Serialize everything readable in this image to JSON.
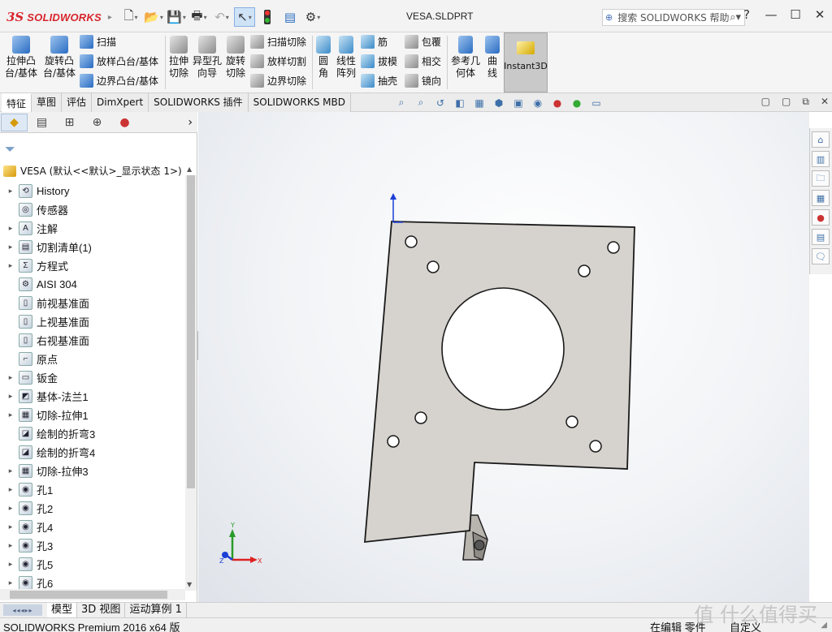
{
  "app": {
    "logo_text": "SOLIDWORKS",
    "document_title": "VESA.SLDPRT",
    "search_placeholder": "搜索 SOLIDWORKS 帮助",
    "window_controls": [
      "?",
      "—",
      "☐",
      "✕"
    ]
  },
  "ribbon": {
    "extrude_boss": "拉伸凸台/基体",
    "revolve_boss": "旋转凸台/基体",
    "sweep": "扫描",
    "loft_boss": "放样凸台/基体",
    "boundary_boss": "边界凸台/基体",
    "extrude_cut": "拉伸切除",
    "hole_wizard": "异型孔向导",
    "revolve_cut": "旋转切除",
    "swept_cut": "扫描切除",
    "lofted_cut": "放样切割",
    "boundary_cut": "边界切除",
    "fillet": "圆角",
    "linear_pattern": "线性阵列",
    "rib": "筋",
    "draft": "拔模",
    "shell": "抽壳",
    "wrap": "包覆",
    "intersect": "相交",
    "mirror": "镜向",
    "ref_geometry": "参考几何体",
    "curves": "曲线",
    "instant3d": "Instant3D"
  },
  "tabs": [
    "特征",
    "草图",
    "评估",
    "DimXpert",
    "SOLIDWORKS 插件",
    "SOLIDWORKS MBD"
  ],
  "tree": {
    "root": "VESA (默认<<默认>_显示状态 1>)",
    "items": [
      {
        "label": "History",
        "expand": true
      },
      {
        "label": "传感器",
        "expand": false
      },
      {
        "label": "注解",
        "expand": true
      },
      {
        "label": "切割清单(1)",
        "expand": true
      },
      {
        "label": "方程式",
        "expand": true
      },
      {
        "label": "AISI 304",
        "expand": false
      },
      {
        "label": "前视基准面",
        "expand": false
      },
      {
        "label": "上视基准面",
        "expand": false
      },
      {
        "label": "右视基准面",
        "expand": false
      },
      {
        "label": "原点",
        "expand": false
      },
      {
        "label": "钣金",
        "expand": true
      },
      {
        "label": "基体-法兰1",
        "expand": true
      },
      {
        "label": "切除-拉伸1",
        "expand": true
      },
      {
        "label": "绘制的折弯3",
        "expand": false
      },
      {
        "label": "绘制的折弯4",
        "expand": false
      },
      {
        "label": "切除-拉伸3",
        "expand": true
      },
      {
        "label": "孔1",
        "expand": true
      },
      {
        "label": "孔2",
        "expand": true
      },
      {
        "label": "孔4",
        "expand": true
      },
      {
        "label": "孔3",
        "expand": true
      },
      {
        "label": "孔5",
        "expand": true
      },
      {
        "label": "孔6",
        "expand": true
      }
    ]
  },
  "bottom_tabs": [
    "模型",
    "3D 视图",
    "运动算例 1"
  ],
  "status": {
    "product": "SOLIDWORKS Premium 2016 x64 版",
    "editing": "在编辑 零件",
    "units": "自定义"
  },
  "watermark": "值 什么值得买",
  "colors": {
    "brand_red": "#d8262d",
    "part_face": "#d6d2cd",
    "accent_blue": "#2a6cc2"
  }
}
